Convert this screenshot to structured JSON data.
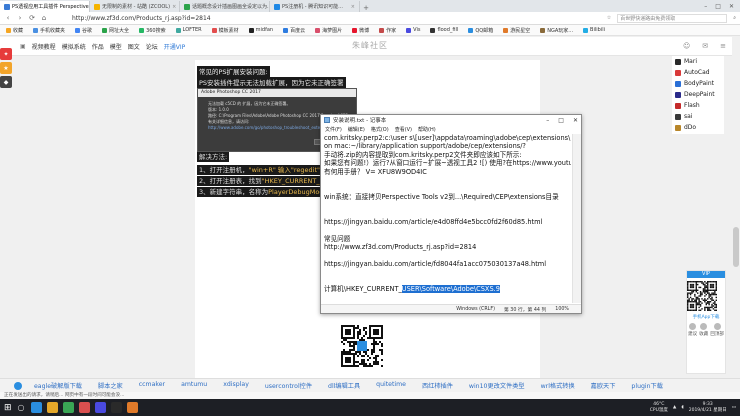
{
  "browser": {
    "tabs": [
      {
        "label": "PS透视应用工具插件 Perspective T...",
        "color": "#3a7bd5",
        "active": true
      },
      {
        "label": "无限制的素材 - 站酷 (ZCOOL)",
        "color": "#f5b400",
        "active": false
      },
      {
        "label": "话题概念设计插画图画全设定以为...",
        "color": "#2ba34a",
        "active": false
      },
      {
        "label": "PS注册机 - 腾讯知识可能...",
        "color": "#1e88e5",
        "active": false
      }
    ],
    "url": "http://www.zf3d.com/Products_rj.asp?id=2814",
    "search_placeholder": "百世野快递路由免费领取",
    "bookmarks": [
      {
        "label": "收藏",
        "color": "#f5a623"
      },
      {
        "label": "手机收藏夹",
        "color": "#4a90e2"
      },
      {
        "label": "谷歌",
        "color": "#4285f4"
      },
      {
        "label": "网址大全",
        "color": "#2ba34a"
      },
      {
        "label": "360搜索",
        "color": "#25b864"
      },
      {
        "label": "LOFTER",
        "color": "#40a9a0"
      },
      {
        "label": "模板素材",
        "color": "#e34d4d"
      },
      {
        "label": "midfan",
        "color": "#222222"
      },
      {
        "label": "百度云",
        "color": "#2e7ce0"
      },
      {
        "label": "海萝图片",
        "color": "#d94f6b"
      },
      {
        "label": "微博",
        "color": "#e6162d"
      },
      {
        "label": "作家",
        "color": "#c44a4a"
      },
      {
        "label": "Vis",
        "color": "#4a4ae0"
      },
      {
        "label": "flood_fill",
        "color": "#333333"
      },
      {
        "label": "QQ邮箱",
        "color": "#2a8ee0"
      },
      {
        "label": "游民星空",
        "color": "#e07a2a"
      },
      {
        "label": "NGA玩家...",
        "color": "#8a6a3a"
      },
      {
        "label": "Bilibili",
        "color": "#23ade5"
      }
    ]
  },
  "site": {
    "nav": [
      "视频教程",
      "模拟系统",
      "作品",
      "模型",
      "图文",
      "论坛"
    ],
    "vip": "开通VIP",
    "logo": "朱峰社区"
  },
  "article": {
    "heading1": "常见的PS扩展安装问题:",
    "heading2": "PS安装插件提示无法加载扩展，因为它未正确签署",
    "ps_dialog": {
      "title": "Adobe Photoshop CC 2017",
      "lines": [
        "无法加载 c5CD 的 扩展，因为它未正确签署。",
        "版本: 1.0.0",
        "路径: C:\\Program Files\\Adobe\\Adobe Photoshop CC 2017\\Required\\CEP",
        "有关详细信息，请访问:",
        "http://www.adobe.com/go/photoshop_troubleshoot_extensions_cn"
      ],
      "ok": "确定"
    },
    "solution_title": "解决方法:",
    "steps": [
      {
        "prefix": "1、打开注册机，",
        "highlight": "\"win+R\" 输入\"regedit\""
      },
      {
        "prefix": "2、打开注册表，找到",
        "highlight": "\"HKEY_CURRENT_USER\""
      },
      {
        "prefix": "3、新建字符串，名称为",
        "highlight": "PlayerDebugMode"
      }
    ]
  },
  "notepad": {
    "title": "安装说明.txt - 记事本",
    "menu": [
      "文件(F)",
      "编辑(E)",
      "格式(O)",
      "查看(V)",
      "帮助(H)"
    ],
    "lines": [
      "com.kritsky.perp2:c:\\user s\\[user]\\appdata\\roaming\\adobe\\cep\\extensions\\",
      "on mac:~/library/application support/adobe/cep/extensions/?",
      "手动将.zip的内容提取到com.kritsky.perp2文件夹即应该如下所示:",
      "如果您有问题!）运行?从窗口运行~扩展~透视工具2 ![)  使用?在https://www.youtube.com/watch上",
      "有何用手册？  V= XFU8W9OD4IC",
      "",
      "",
      "win系统：直接拷贝Perspective Tools v2到...\\Required\\CEP\\extensions目录",
      "",
      "",
      "https://jingyan.baidu.com/article/e4d08ffd4e5bcc0fd2f60d85.html",
      "",
      "常见问题",
      "http://www.zf3d.com/Products_rj.asp?id=2814",
      "",
      "https://jingyan.baidu.com/article/fd8044fa1acc075030137a48.html",
      "",
      ""
    ],
    "last_line_prefix": "计算机\\HKEY_CURRENT_",
    "last_line_selected": "USER\\Software\\Adobe\\CSXS.9",
    "status": {
      "eol": "Windows (CRLF)",
      "position": "第 30 行，第 44 列",
      "zoom": "100%"
    }
  },
  "sidebar": {
    "software": [
      {
        "label": "Mari",
        "color": "#2a2a2a"
      },
      {
        "label": "AutoCad",
        "color": "#d93a3a"
      },
      {
        "label": "BodyPaint",
        "color": "#2a6fd6"
      },
      {
        "label": "DeepPaint",
        "color": "#2a2a8a"
      },
      {
        "label": "Flash",
        "color": "#c42a2a"
      },
      {
        "label": "sai",
        "color": "#3a3a3a"
      },
      {
        "label": "dDo",
        "color": "#b8862a"
      }
    ],
    "vip_tag": "VIP",
    "app_label": "手机App下载",
    "actions": [
      "建议",
      "收藏",
      "回顶部"
    ]
  },
  "tags": [
    "eagle破解版下载",
    "脚本之家",
    "ccmaker",
    "amtumu",
    "xdisplay",
    "usercontrol控件",
    "dll编辑工具",
    "quitetime",
    "西红柿插件",
    "win10更改文件类型",
    "wrl格式转换",
    "嘉欧天下",
    "plugin下载"
  ],
  "status_text": "正在发送出的请求，请稍后... 网页中有一段时间可能会没...",
  "taskbar": {
    "icons": [
      "#2a8ee0",
      "#e5a82a",
      "#3aa655",
      "#d94f4f",
      "#4a4ae0",
      "#2a2a2a",
      "#e07a2a"
    ],
    "temp": "46°C",
    "temp_label": "CPU温度",
    "time": "9:33",
    "date": "2019/4/21 星期日"
  }
}
